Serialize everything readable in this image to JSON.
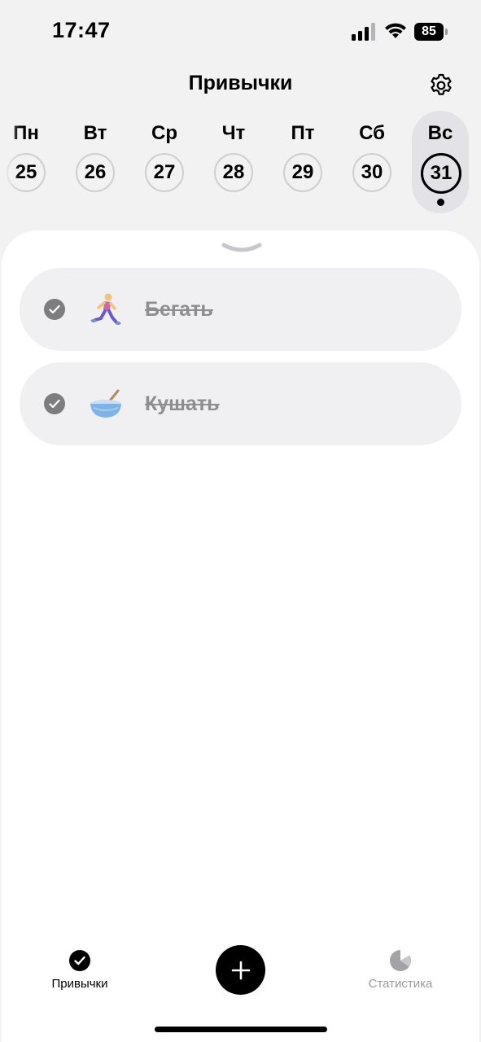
{
  "status_bar": {
    "time": "17:47",
    "battery_level": "85",
    "signal_bars": 3,
    "icons": [
      "cellular-signal-icon",
      "wifi-icon",
      "battery-icon"
    ]
  },
  "header": {
    "title": "Привычки",
    "settings_icon": "gear-icon"
  },
  "week": {
    "days": [
      {
        "name": "Пн",
        "number": "25"
      },
      {
        "name": "Вт",
        "number": "26"
      },
      {
        "name": "Ср",
        "number": "27"
      },
      {
        "name": "Чт",
        "number": "28"
      },
      {
        "name": "Пт",
        "number": "29"
      },
      {
        "name": "Сб",
        "number": "30"
      },
      {
        "name": "Вс",
        "number": "31"
      }
    ],
    "selected_index": 6
  },
  "habits": [
    {
      "name": "Бегать",
      "emoji": "running-person-icon",
      "done": true
    },
    {
      "name": "Кушать",
      "emoji": "bowl-icon",
      "done": true
    }
  ],
  "tab_bar": {
    "habits_label": "Привычки",
    "stats_label": "Статистика",
    "add_icon": "plus-icon",
    "active_tab": "habits"
  },
  "colors": {
    "background": "#f2f2f3",
    "card": "#f0f0f2",
    "check": "#7d7d80",
    "done_text": "#8e8e92",
    "inactive_tab": "#9a9a9e"
  }
}
